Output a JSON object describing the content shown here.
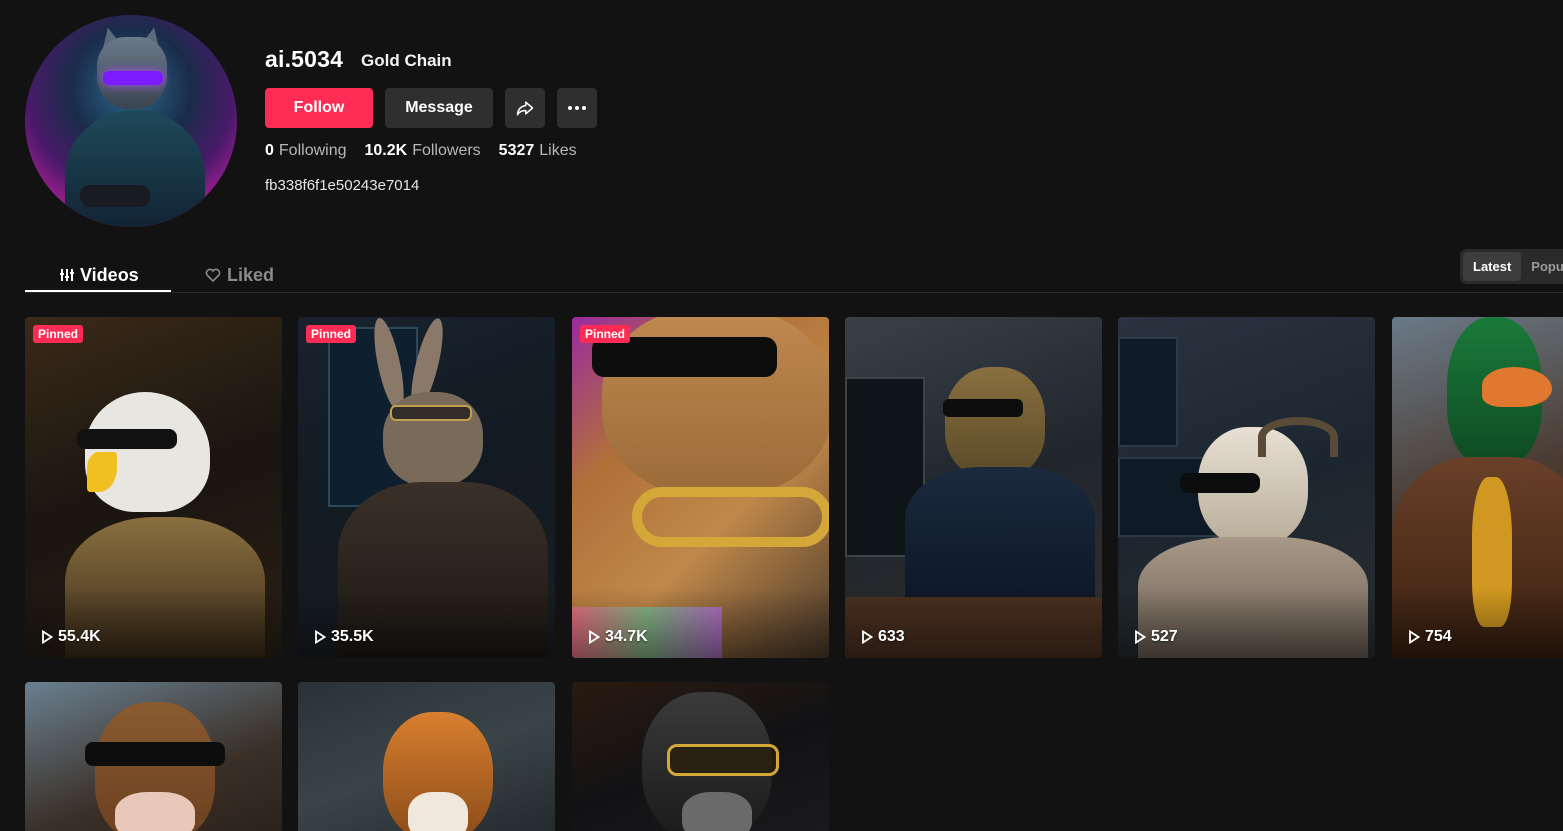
{
  "profile": {
    "username": "ai.5034",
    "nickname": "Gold Chain",
    "bio": "fb338f6f1e50243e7014",
    "follow_label": "Follow",
    "message_label": "Message",
    "stats": {
      "following_count": "0",
      "following_label": "Following",
      "followers_count": "10.2K",
      "followers_label": "Followers",
      "likes_count": "5327",
      "likes_label": "Likes"
    }
  },
  "tabs": {
    "videos": "Videos",
    "liked": "Liked"
  },
  "sort": {
    "latest": "Latest",
    "popular": "Popular"
  },
  "colors": {
    "accent": "#fe2c55",
    "background": "#121212",
    "button_dark": "#2f2f2f"
  },
  "videos": [
    {
      "subject": "eagle",
      "views": "55.4K",
      "pinned": "Pinned"
    },
    {
      "subject": "rabbit",
      "views": "35.5K",
      "pinned": "Pinned"
    },
    {
      "subject": "cat",
      "views": "34.7K",
      "pinned": "Pinned"
    },
    {
      "subject": "dragon",
      "views": "633"
    },
    {
      "subject": "goat",
      "views": "527"
    },
    {
      "subject": "duck",
      "views": "754"
    },
    {
      "subject": "bull"
    },
    {
      "subject": "tiger"
    },
    {
      "subject": "gorilla"
    }
  ]
}
